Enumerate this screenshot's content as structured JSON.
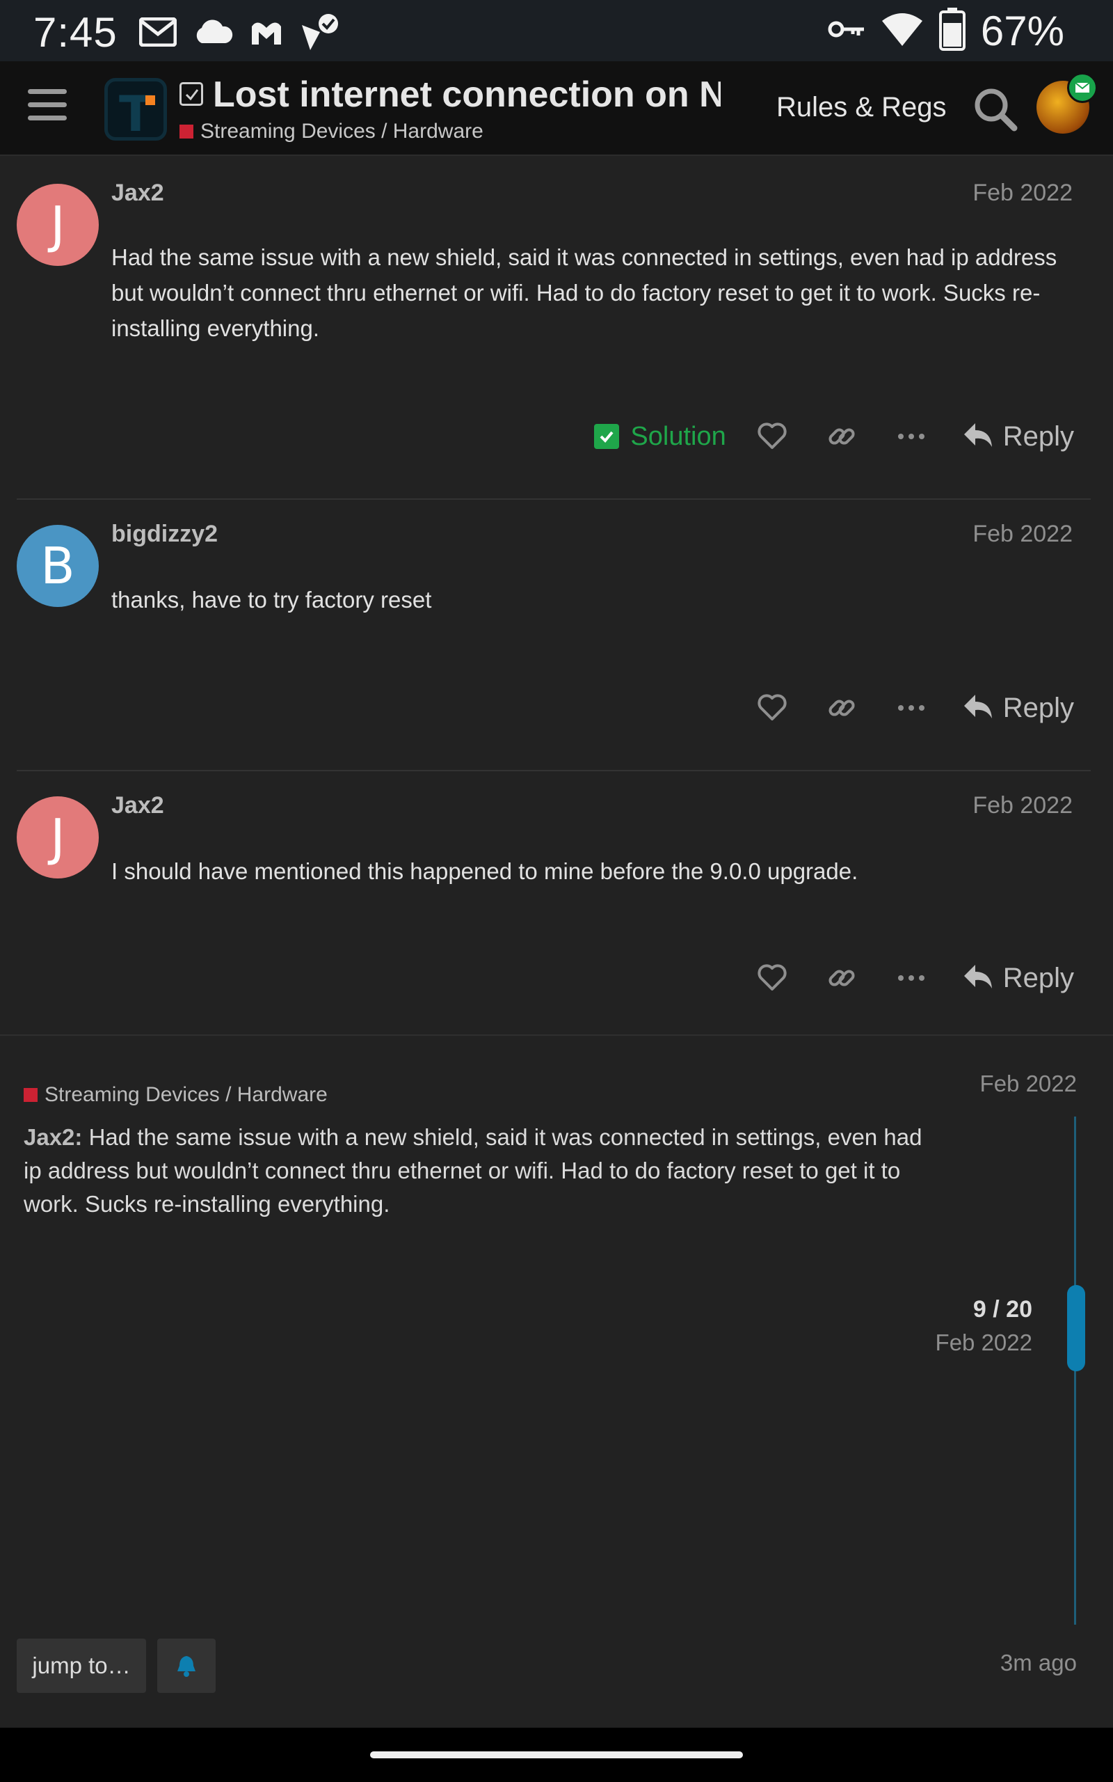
{
  "status_bar": {
    "time": "7:45",
    "battery": "67%",
    "left_icons": [
      "gmail-icon",
      "cloud-icon",
      "malwarebytes-icon",
      "tasks-check-icon"
    ],
    "right_icons": [
      "vpn-key-icon",
      "wifi-icon",
      "battery-icon"
    ]
  },
  "header": {
    "title": "Lost internet connection on N...",
    "category": "Streaming Devices / Hardware",
    "category_color": "#cc2233",
    "rules_link": "Rules & Regs"
  },
  "posts": [
    {
      "username": "Jax2",
      "avatar_letter": "J",
      "avatar_color": "#e27a7a",
      "date": "Feb 2022",
      "body": "Had the same issue with a new shield, said it was connected in settings, even had ip address but wouldn’t connect thru ethernet or wifi. Had to do factory reset to get it to work. Sucks re-installing everything.",
      "solution_label": "Solution",
      "reply_label": "Reply"
    },
    {
      "username": "bigdizzy2",
      "avatar_letter": "B",
      "avatar_color": "#4a95c4",
      "date": "Feb 2022",
      "body": "thanks, have to try factory reset",
      "reply_label": "Reply"
    },
    {
      "username": "Jax2",
      "avatar_letter": "J",
      "avatar_color": "#e27a7a",
      "date": "Feb 2022",
      "body": "I should have mentioned this happened to mine before the 9.0.0 upgrade.",
      "reply_label": "Reply"
    }
  ],
  "timeline": {
    "category": "Streaming Devices / Hardware",
    "start_date": "Feb 2022",
    "excerpt_author": "Jax2:",
    "excerpt_text": " Had the same issue with a new shield, said it was connected in settings, even had ip address but wouldn’t connect thru ethernet or wifi. Had to do factory reset to get it to work. Sucks re-installing everything.",
    "position": "9 / 20",
    "position_date": "Feb 2022",
    "jump_label": "jump to…",
    "last_activity": "3m ago"
  },
  "colors": {
    "background": "#222222",
    "header": "#111111",
    "solution_green": "#1fa64a",
    "timeline_blue": "#0d7fb0"
  }
}
